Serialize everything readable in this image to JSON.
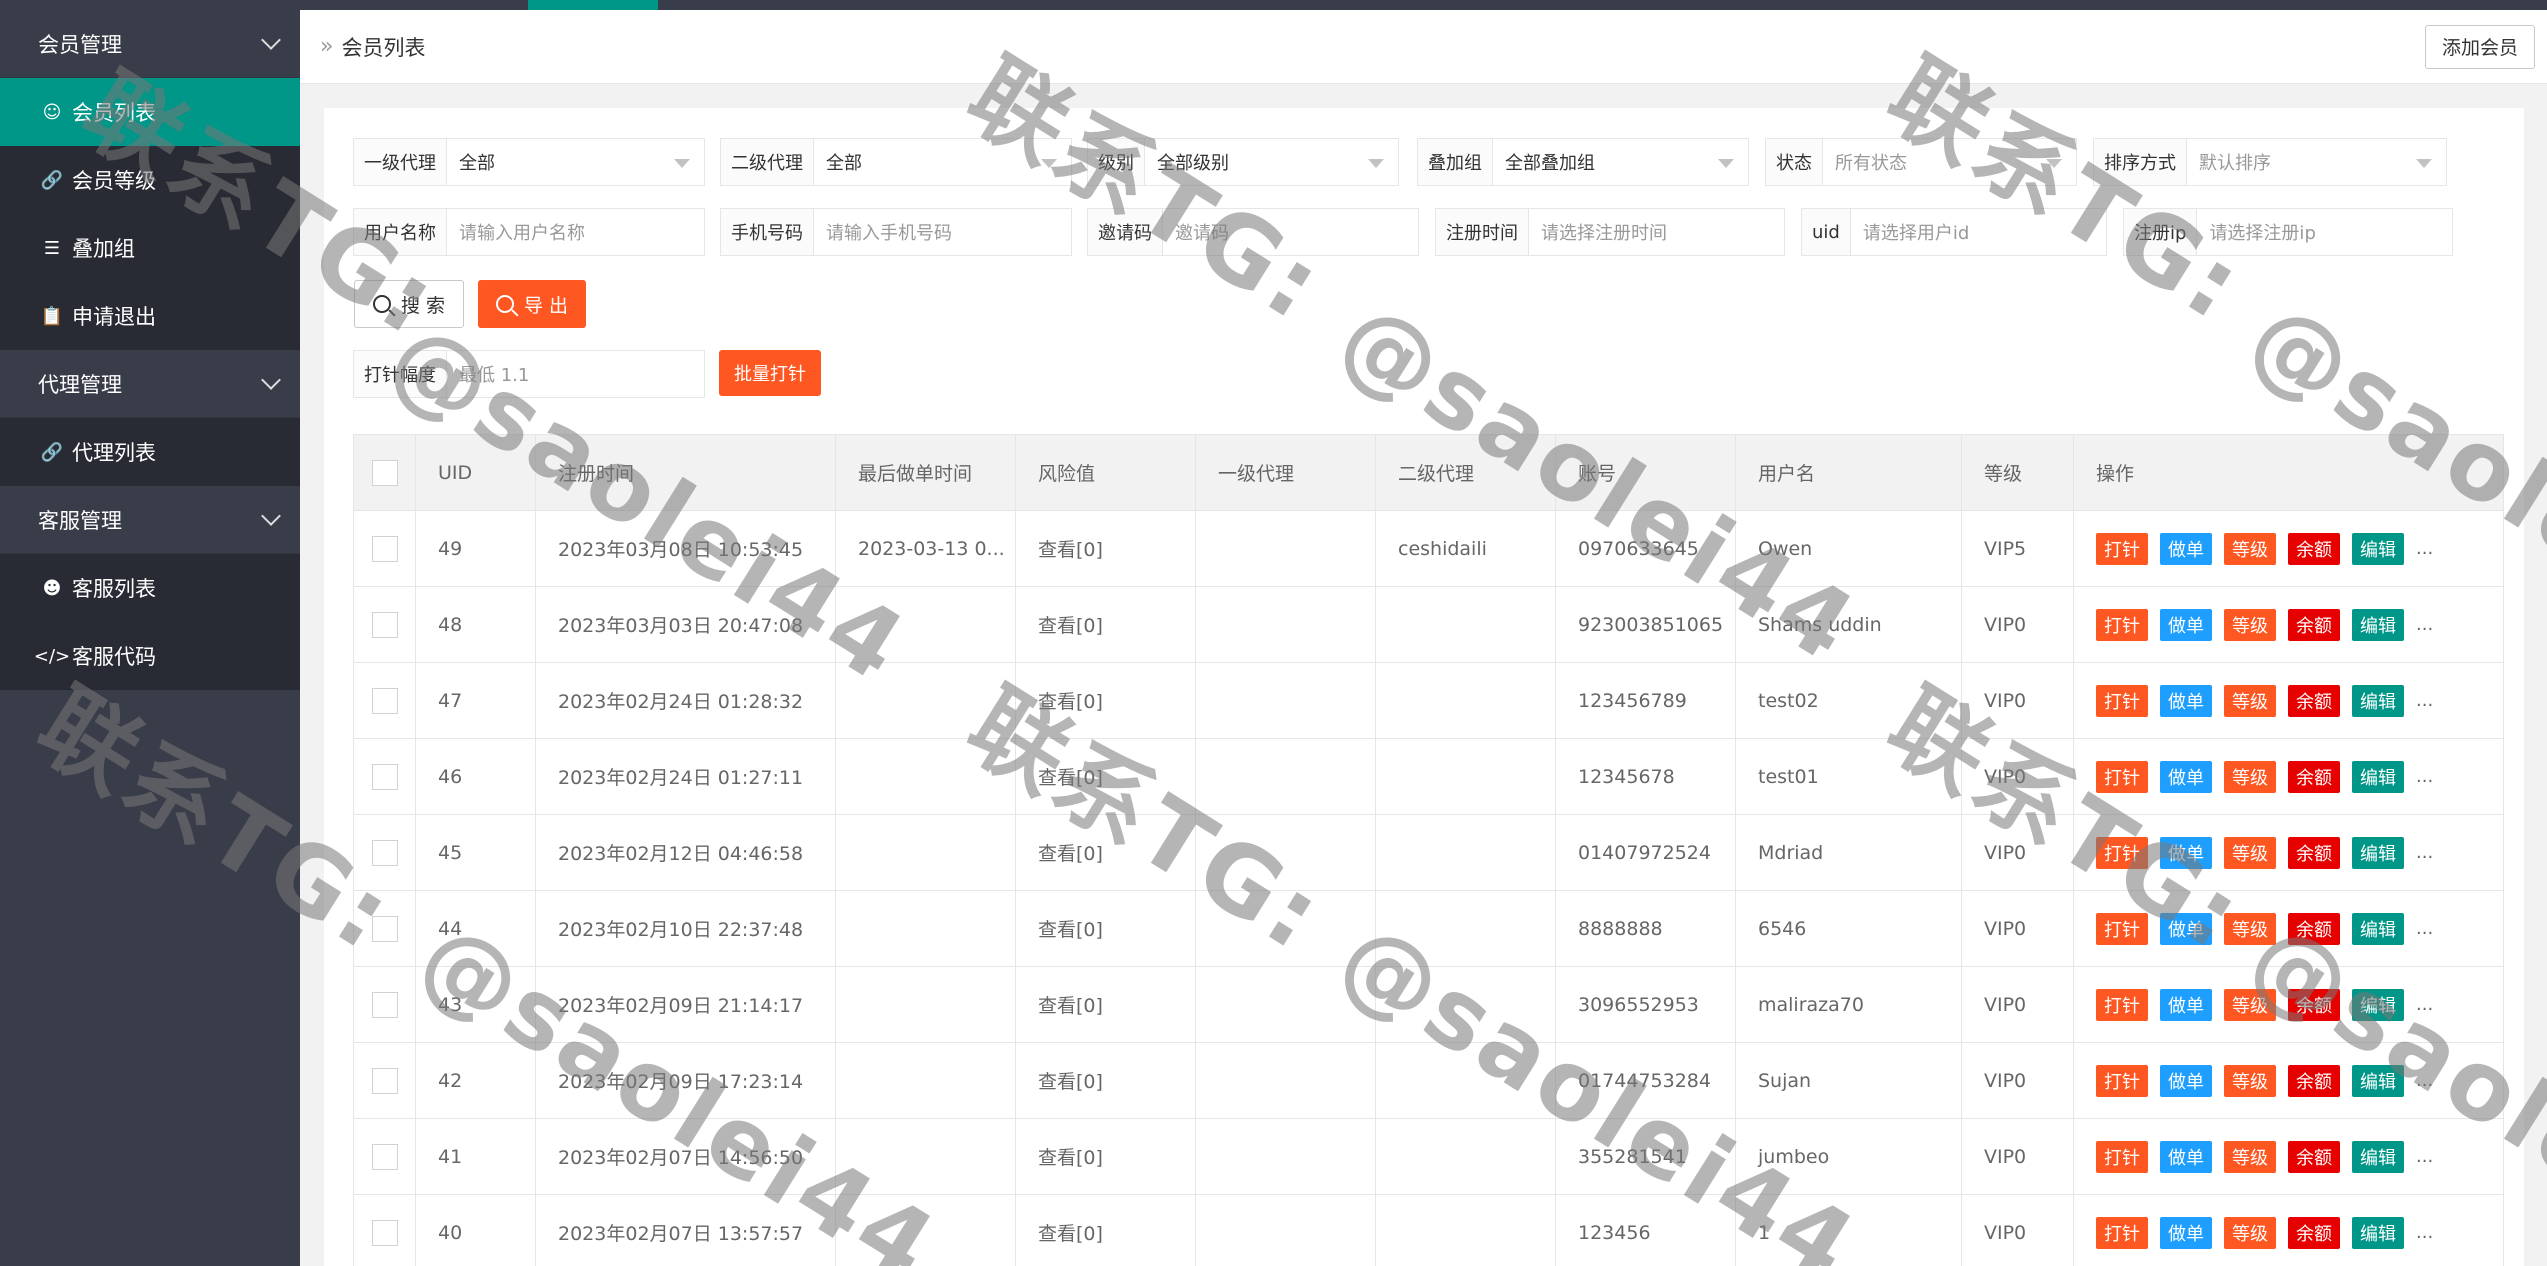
{
  "sidebar": {
    "groups": [
      {
        "label": "会员管理",
        "items": [
          {
            "label": "会员列表",
            "icon": "user-icon",
            "active": true
          },
          {
            "label": "会员等级",
            "icon": "link-icon"
          },
          {
            "label": "叠加组",
            "icon": "list-icon"
          },
          {
            "label": "申请退出",
            "icon": "clipboard-icon"
          }
        ]
      },
      {
        "label": "代理管理",
        "items": [
          {
            "label": "代理列表",
            "icon": "link-icon"
          }
        ]
      },
      {
        "label": "客服管理",
        "items": [
          {
            "label": "客服列表",
            "icon": "users-icon"
          },
          {
            "label": "客服代码",
            "icon": "code-icon"
          }
        ]
      }
    ]
  },
  "header": {
    "breadcrumb": "会员列表",
    "add_label": "添加会员"
  },
  "filters": {
    "level1_agent": {
      "label": "一级代理",
      "value": "全部"
    },
    "level2_agent": {
      "label": "二级代理",
      "value": "全部"
    },
    "grade": {
      "label": "级别",
      "value": "全部级别"
    },
    "stack_group": {
      "label": "叠加组",
      "value": "全部叠加组"
    },
    "status": {
      "label": "状态",
      "placeholder": "所有状态"
    },
    "sort": {
      "label": "排序方式",
      "placeholder": "默认排序"
    },
    "username": {
      "label": "用户名称",
      "placeholder": "请输入用户名称"
    },
    "phone": {
      "label": "手机号码",
      "placeholder": "请输入手机号码"
    },
    "invite": {
      "label": "邀请码",
      "placeholder": "邀请码"
    },
    "reg_time": {
      "label": "注册时间",
      "placeholder": "请选择注册时间"
    },
    "uid": {
      "label": "uid",
      "placeholder": "请选择用户id"
    },
    "reg_ip": {
      "label": "注册ip",
      "placeholder": "请选择注册ip"
    },
    "inject": {
      "label": "打针幅度",
      "placeholder": "最低 1.1"
    }
  },
  "buttons": {
    "search": "搜 索",
    "export": "导 出",
    "batch": "批量打针"
  },
  "table": {
    "columns": [
      "UID",
      "注册时间",
      "最后做单时间",
      "风险值",
      "一级代理",
      "二级代理",
      "账号",
      "用户名",
      "等级",
      "操作"
    ],
    "actions": [
      "打针",
      "做单",
      "等级",
      "余额",
      "编辑"
    ],
    "more": "...",
    "rows": [
      {
        "uid": "49",
        "reg": "2023年03月08日 10:53:45",
        "last": "2023-03-13 0...",
        "risk": "查看[0]",
        "a1": "",
        "a2": "ceshidaili",
        "account": "0970633645",
        "name": "Owen",
        "level": "VIP5"
      },
      {
        "uid": "48",
        "reg": "2023年03月03日 20:47:08",
        "last": "",
        "risk": "查看[0]",
        "a1": "",
        "a2": "",
        "account": "923003851065",
        "name": "Shams uddin",
        "level": "VIP0"
      },
      {
        "uid": "47",
        "reg": "2023年02月24日 01:28:32",
        "last": "",
        "risk": "查看[0]",
        "a1": "",
        "a2": "",
        "account": "123456789",
        "name": "test02",
        "level": "VIP0"
      },
      {
        "uid": "46",
        "reg": "2023年02月24日 01:27:11",
        "last": "",
        "risk": "查看[0]",
        "a1": "",
        "a2": "",
        "account": "12345678",
        "name": "test01",
        "level": "VIP0"
      },
      {
        "uid": "45",
        "reg": "2023年02月12日 04:46:58",
        "last": "",
        "risk": "查看[0]",
        "a1": "",
        "a2": "",
        "account": "01407972524",
        "name": "Mdriad",
        "level": "VIP0"
      },
      {
        "uid": "44",
        "reg": "2023年02月10日 22:37:48",
        "last": "",
        "risk": "查看[0]",
        "a1": "",
        "a2": "",
        "account": "8888888",
        "name": "6546",
        "level": "VIP0"
      },
      {
        "uid": "43",
        "reg": "2023年02月09日 21:14:17",
        "last": "",
        "risk": "查看[0]",
        "a1": "",
        "a2": "",
        "account": "3096552953",
        "name": "maliraza70",
        "level": "VIP0"
      },
      {
        "uid": "42",
        "reg": "2023年02月09日 17:23:14",
        "last": "",
        "risk": "查看[0]",
        "a1": "",
        "a2": "",
        "account": "01744753284",
        "name": "Sujan",
        "level": "VIP0"
      },
      {
        "uid": "41",
        "reg": "2023年02月07日 14:56:50",
        "last": "",
        "risk": "查看[0]",
        "a1": "",
        "a2": "",
        "account": "355281541",
        "name": "jumbeo",
        "level": "VIP0"
      },
      {
        "uid": "40",
        "reg": "2023年02月07日 13:57:57",
        "last": "",
        "risk": "查看[0]",
        "a1": "",
        "a2": "",
        "account": "123456",
        "name": "1",
        "level": "VIP0"
      }
    ]
  },
  "watermark": {
    "line1": "联系TG:",
    "line2": "@saolei44"
  }
}
